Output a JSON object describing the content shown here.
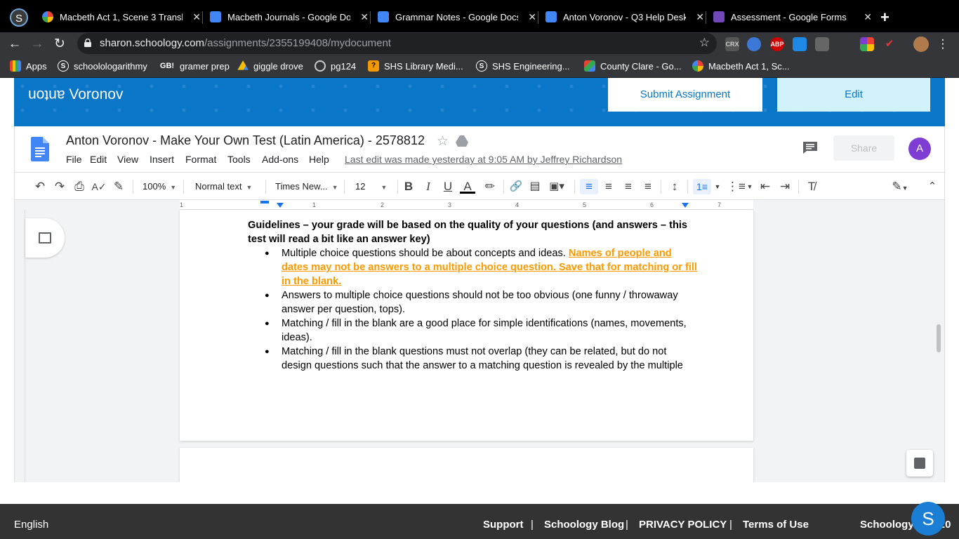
{
  "browser": {
    "profile_letter": "S",
    "tabs": [
      {
        "title": "Macbeth Act 1, Scene 3 Transla",
        "icon_color": "#ffffff"
      },
      {
        "title": "Macbeth Journals - Google Doc",
        "icon_color": "#4285f4"
      },
      {
        "title": "Grammar Notes - Google Docs",
        "icon_color": "#4285f4"
      },
      {
        "title": "Anton Voronov - Q3 Help Desk",
        "icon_color": "#4285f4"
      },
      {
        "title": "Assessment - Google Forms",
        "icon_color": "#7248b9"
      }
    ],
    "close_glyph": "✕",
    "new_tab_glyph": "+",
    "url_host": "sharon.schoology.com",
    "url_path": "/assignments/2355199408/mydocument",
    "extensions": [
      "CRX",
      "ABP"
    ],
    "bookmarks": [
      {
        "label": "Apps",
        "icon": "apps-grid-icon"
      },
      {
        "label": "schoolologarithmy",
        "icon": "schoology-icon"
      },
      {
        "label": "gramer prep",
        "icon": "gb-icon",
        "icon_text": "GB!"
      },
      {
        "label": "giggle drove",
        "icon": "drive-icon"
      },
      {
        "label": "pg124",
        "icon": "globe-icon"
      },
      {
        "label": "SHS Library Medi...",
        "icon": "library-icon"
      },
      {
        "label": "SHS Engineering...",
        "icon": "schoology-icon"
      },
      {
        "label": "County Clare - Go...",
        "icon": "image-icon"
      },
      {
        "label": "Macbeth Act 1, Sc...",
        "icon": "bookmark-icon"
      }
    ]
  },
  "schoology": {
    "user_name_flipped": "anton",
    "user_name": "Voronov",
    "submit_label": "Submit Assignment",
    "edit_label": "Edit"
  },
  "docs": {
    "title": "Anton Voronov - Make Your Own Test (Latin America) - 2578812",
    "menu": [
      "File",
      "Edit",
      "View",
      "Insert",
      "Format",
      "Tools",
      "Add-ons",
      "Help"
    ],
    "last_edit": "Last edit was made yesterday at 9:05 AM by Jeffrey Richardson",
    "share_label": "Share",
    "avatar_letter": "A",
    "toolbar": {
      "zoom": "100%",
      "style": "Normal text",
      "font": "Times New...",
      "size": "12"
    },
    "ruler_numbers": [
      "1",
      "1",
      "2",
      "3",
      "4",
      "5",
      "6",
      "7"
    ],
    "content": {
      "heading": "Guidelines – your grade will be based on the quality of your questions (and answers – this test will read a bit like an answer key)",
      "bullets": [
        {
          "text": "Multiple choice questions should be about concepts and ideas.  ",
          "highlight": "Names of people and dates may not be answers to a multiple choice question.  Save that for matching or fill in the blank."
        },
        {
          "text": "Answers to multiple choice questions should not be too obvious (one funny / throwaway answer per question, tops).",
          "highlight": ""
        },
        {
          "text": "Matching / fill in the blank are a good place for simple identifications (names, movements, ideas).",
          "highlight": ""
        },
        {
          "text": "Matching / fill in the blank questions must not overlap (they can be related, but do not design questions such that the answer to a matching question is revealed by the multiple",
          "highlight": ""
        }
      ]
    }
  },
  "footer": {
    "language": "English",
    "links": [
      "Support",
      "Schoology Blog",
      "PRIVACY POLICY",
      "Terms of Use"
    ],
    "separator": "|",
    "brand": "Schoology © 2020",
    "chat_letter": "S"
  }
}
